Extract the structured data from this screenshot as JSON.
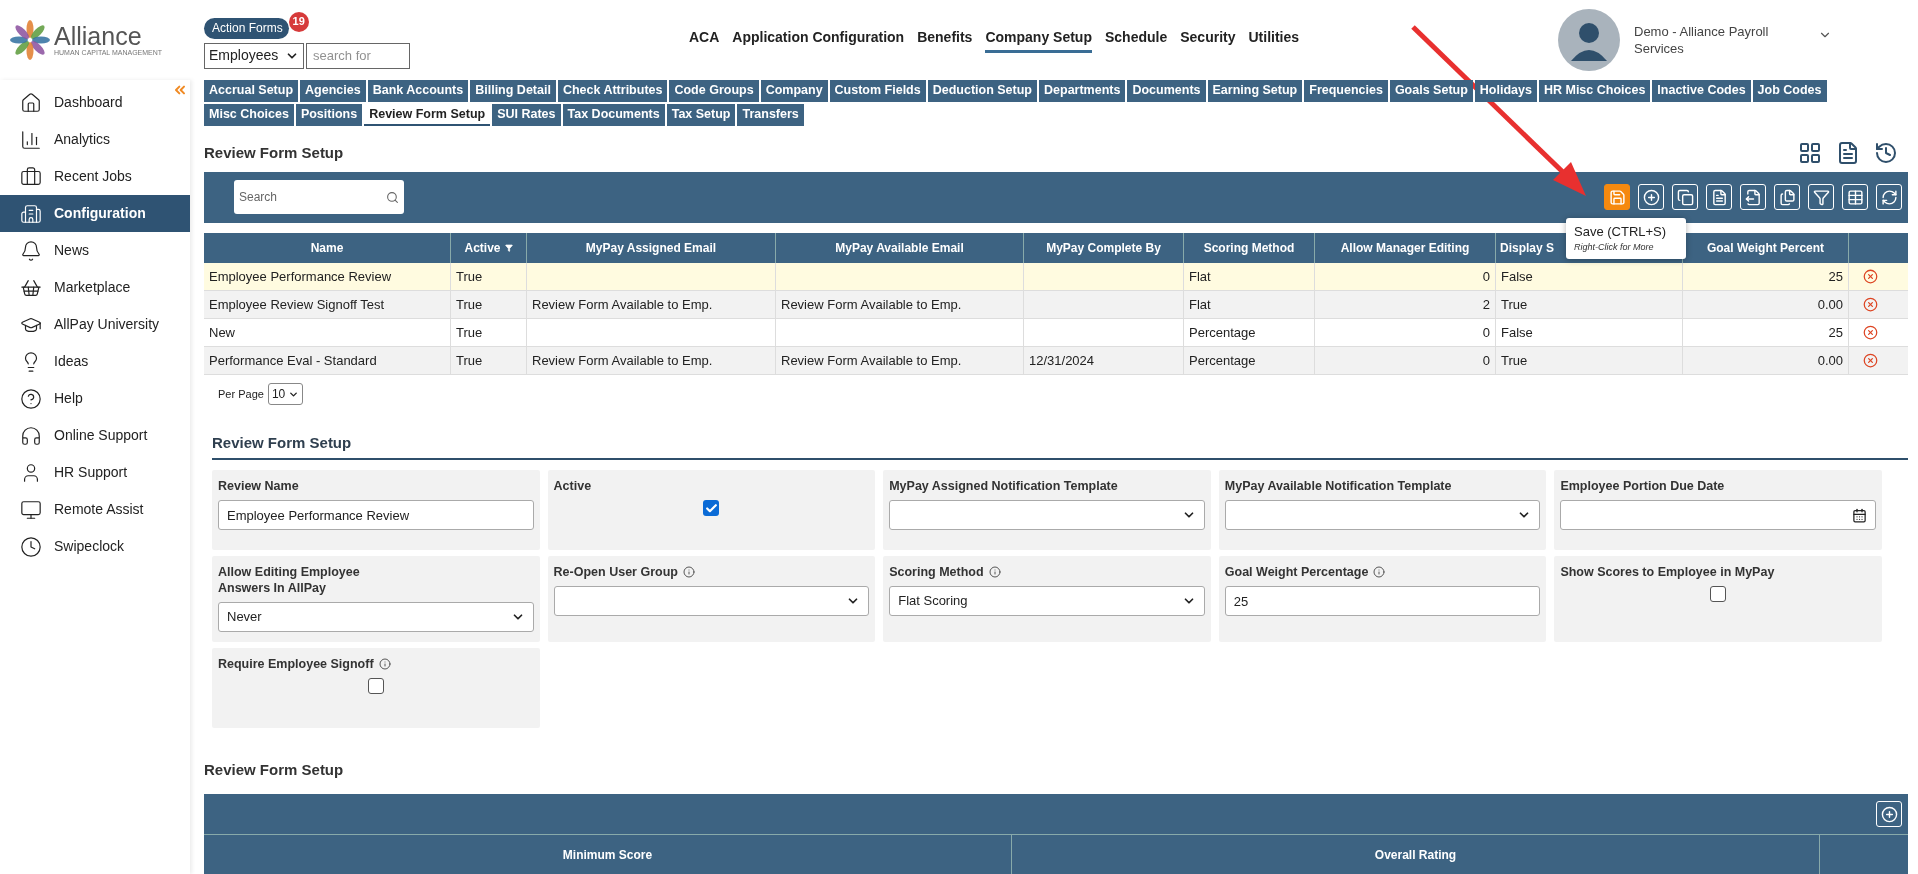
{
  "header": {
    "logo_name": "Alliance",
    "logo_tagline": "HUMAN CAPITAL MANAGEMENT",
    "action_forms": {
      "label": "Action Forms",
      "count": "19"
    },
    "search_scope": "Employees",
    "search_placeholder": "search for",
    "nav": [
      {
        "label": "ACA",
        "selected": false
      },
      {
        "label": "Application Configuration",
        "selected": false
      },
      {
        "label": "Benefits",
        "selected": false
      },
      {
        "label": "Company Setup",
        "selected": true
      },
      {
        "label": "Schedule",
        "selected": false
      },
      {
        "label": "Security",
        "selected": false
      },
      {
        "label": "Utilities",
        "selected": false
      }
    ],
    "user": "Demo - Alliance Payroll Services"
  },
  "sidebar": {
    "items": [
      {
        "label": "Dashboard",
        "selected": false
      },
      {
        "label": "Analytics",
        "selected": false
      },
      {
        "label": "Recent Jobs",
        "selected": false
      },
      {
        "label": "Configuration",
        "selected": true
      },
      {
        "label": "News",
        "selected": false
      },
      {
        "label": "Marketplace",
        "selected": false
      },
      {
        "label": "AllPay University",
        "selected": false
      },
      {
        "label": "Ideas",
        "selected": false
      },
      {
        "label": "Help",
        "selected": false
      },
      {
        "label": "Online Support",
        "selected": false
      },
      {
        "label": "HR Support",
        "selected": false
      },
      {
        "label": "Remote Assist",
        "selected": false
      },
      {
        "label": "Swipeclock",
        "selected": false
      }
    ]
  },
  "tabs": [
    {
      "label": "Accrual Setup",
      "selected": false
    },
    {
      "label": "Agencies",
      "selected": false
    },
    {
      "label": "Bank Accounts",
      "selected": false
    },
    {
      "label": "Billing Detail",
      "selected": false
    },
    {
      "label": "Check Attributes",
      "selected": false
    },
    {
      "label": "Code Groups",
      "selected": false
    },
    {
      "label": "Company",
      "selected": false
    },
    {
      "label": "Custom Fields",
      "selected": false
    },
    {
      "label": "Deduction Setup",
      "selected": false
    },
    {
      "label": "Departments",
      "selected": false
    },
    {
      "label": "Documents",
      "selected": false
    },
    {
      "label": "Earning Setup",
      "selected": false
    },
    {
      "label": "Frequencies",
      "selected": false
    },
    {
      "label": "Goals Setup",
      "selected": false
    },
    {
      "label": "Holidays",
      "selected": false
    },
    {
      "label": "HR Misc Choices",
      "selected": false
    },
    {
      "label": "Inactive Codes",
      "selected": false
    },
    {
      "label": "Job Codes",
      "selected": false
    },
    {
      "label": "Misc Choices",
      "selected": false
    },
    {
      "label": "Positions",
      "selected": false
    },
    {
      "label": "Review Form Setup",
      "selected": true
    },
    {
      "label": "SUI Rates",
      "selected": false
    },
    {
      "label": "Tax Documents",
      "selected": false
    },
    {
      "label": "Tax Setup",
      "selected": false
    },
    {
      "label": "Transfers",
      "selected": false
    }
  ],
  "page_title": "Review Form Setup",
  "grid": {
    "search_placeholder": "Search",
    "tooltip": {
      "title": "Save (CTRL+S)",
      "hint": "Right-Click for More"
    },
    "columns": [
      "Name",
      "Active",
      "MyPay Assigned Email",
      "MyPay Available Email",
      "MyPay Complete By",
      "Scoring Method",
      "Allow Manager Editing",
      "Display S",
      "Goal Weight Percent"
    ],
    "rows": [
      {
        "selected": true,
        "cells": [
          "Employee Performance Review",
          "True",
          "",
          "",
          "",
          "Flat",
          "0",
          "False",
          "25"
        ]
      },
      {
        "selected": false,
        "cells": [
          "Employee Review Signoff Test",
          "True",
          "Review Form Available to Emp.",
          "Review Form Available to Emp.",
          "",
          "Flat",
          "2",
          "True",
          "0.00"
        ]
      },
      {
        "selected": false,
        "cells": [
          "New",
          "True",
          "",
          "",
          "",
          "Percentage",
          "0",
          "False",
          "25"
        ]
      },
      {
        "selected": false,
        "cells": [
          "Performance Eval - Standard",
          "True",
          "Review Form Available to Emp.",
          "Review Form Available to Emp.",
          "12/31/2024",
          "Percentage",
          "0",
          "True",
          "0.00"
        ]
      }
    ],
    "per_page_label": "Per Page",
    "per_page": "10"
  },
  "form": {
    "title": "Review Form Setup",
    "fields": [
      {
        "kind": "text",
        "label": "Review Name",
        "value": "Employee Performance Review",
        "info": false
      },
      {
        "kind": "checkbox",
        "label": "Active",
        "checked": true,
        "info": false
      },
      {
        "kind": "select",
        "label": "MyPay Assigned Notification Template",
        "info": false
      },
      {
        "kind": "select",
        "label": "MyPay Available Notification Template",
        "info": false
      },
      {
        "kind": "date",
        "label": "Employee Portion Due Date",
        "info": false
      },
      {
        "kind": "select",
        "label": "Allow Editing Employee Answers In AllPay",
        "value": "Never",
        "info": false
      },
      {
        "kind": "select",
        "label": "Re-Open User Group",
        "info": true
      },
      {
        "kind": "select",
        "label": "Scoring Method",
        "value": "Flat Scoring",
        "info": true
      },
      {
        "kind": "text",
        "label": "Goal Weight Percentage",
        "value": "25",
        "info": true
      },
      {
        "kind": "checkbox",
        "label": "Show Scores to Employee in MyPay",
        "checked": false,
        "info": false
      },
      {
        "kind": "checkbox",
        "label": "Require Employee Signoff",
        "checked": false,
        "info": true
      }
    ]
  },
  "ratings": {
    "title": "Review Form Setup",
    "columns": [
      "Minimum Score",
      "Overall Rating"
    ]
  }
}
